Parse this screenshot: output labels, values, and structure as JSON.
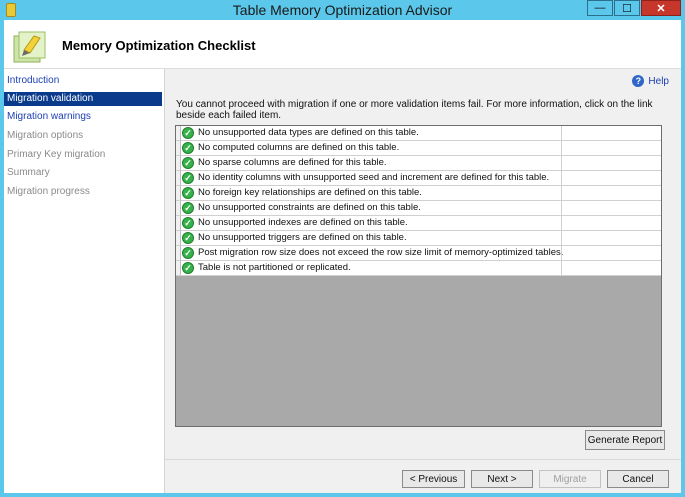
{
  "window": {
    "title": "Table Memory Optimization Advisor",
    "controls": {
      "minimize": "—",
      "maximize": "☐",
      "close": "✕"
    }
  },
  "header": {
    "title": "Memory Optimization Checklist"
  },
  "sidebar": {
    "items": [
      {
        "label": "Introduction",
        "state": "link"
      },
      {
        "label": "Migration validation",
        "state": "active"
      },
      {
        "label": "Migration warnings",
        "state": "link"
      },
      {
        "label": "Migration options",
        "state": "disabled"
      },
      {
        "label": "Primary Key migration",
        "state": "disabled"
      },
      {
        "label": "Summary",
        "state": "disabled"
      },
      {
        "label": "Migration progress",
        "state": "disabled"
      }
    ]
  },
  "main": {
    "help_label": "Help",
    "help_icon": "?",
    "intro": "You cannot proceed with migration if one or more validation items fail. For more information, click on the link beside each failed item.",
    "checks": [
      {
        "text": "No unsupported data types are defined on this table.",
        "status": "passed"
      },
      {
        "text": "No computed columns are defined on this table.",
        "status": "passed"
      },
      {
        "text": "No sparse columns are defined for this table.",
        "status": "passed"
      },
      {
        "text": "No identity columns with unsupported seed and increment are defined for this table.",
        "status": "passed"
      },
      {
        "text": "No foreign key relationships are defined on this table.",
        "status": "passed"
      },
      {
        "text": "No unsupported constraints are defined on this table.",
        "status": "passed"
      },
      {
        "text": "No unsupported indexes are defined on this table.",
        "status": "passed"
      },
      {
        "text": "No unsupported triggers are defined on this table.",
        "status": "passed"
      },
      {
        "text": "Post migration row size does not exceed the row size limit of memory-optimized tables.",
        "status": "passed"
      },
      {
        "text": "Table is not partitioned or replicated.",
        "status": "passed"
      }
    ],
    "generate_report_label": "Generate Report"
  },
  "footer": {
    "previous_label": "< Previous",
    "next_label": "Next >",
    "migrate_label": "Migrate",
    "cancel_label": "Cancel"
  },
  "colors": {
    "title_bar": "#5bc7ea",
    "active_nav": "#0a3a8c",
    "link": "#1c40b5",
    "check": "#36b24a",
    "close": "#c7362a"
  }
}
